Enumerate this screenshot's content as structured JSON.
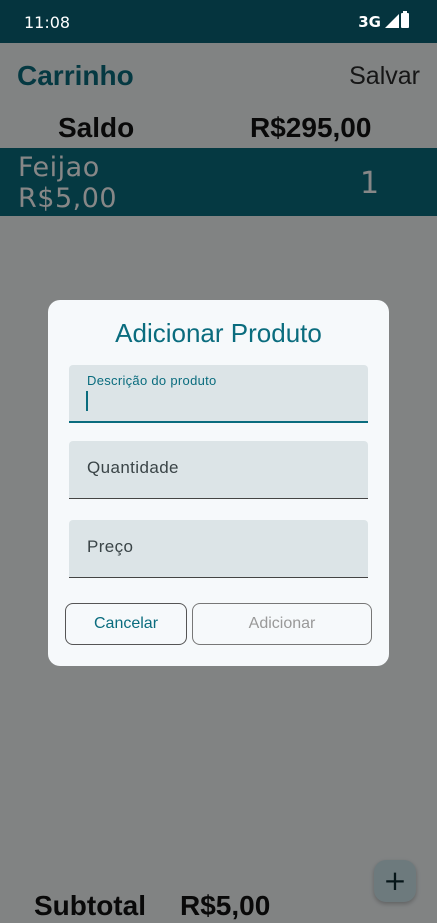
{
  "status_bar": {
    "time": "11:08",
    "network": "3G",
    "signal_icon": "signal-icon",
    "battery_icon": "battery-icon"
  },
  "app_bar": {
    "title": "Carrinho",
    "save_label": "Salvar"
  },
  "balance": {
    "label": "Saldo",
    "value": "R$295,00"
  },
  "cart": {
    "items": [
      {
        "name": "Feijao",
        "price": "R$5,00",
        "quantity": "1"
      }
    ]
  },
  "footer": {
    "subtotal_label": "Subtotal",
    "subtotal_value": "R$5,00"
  },
  "fab": {
    "icon": "plus-icon",
    "symbol": "+"
  },
  "dialog": {
    "title": "Adicionar Produto",
    "fields": {
      "description": {
        "label": "Descrição do produto",
        "value": ""
      },
      "quantity": {
        "placeholder": "Quantidade",
        "value": ""
      },
      "price": {
        "placeholder": "Preço",
        "value": ""
      }
    },
    "cancel_label": "Cancelar",
    "add_label": "Adicionar"
  },
  "colors": {
    "primary": "#0a6c7e",
    "status_bar": "#05343e",
    "dialog_bg": "#f6f9fb",
    "field_bg": "#dce4e7"
  }
}
